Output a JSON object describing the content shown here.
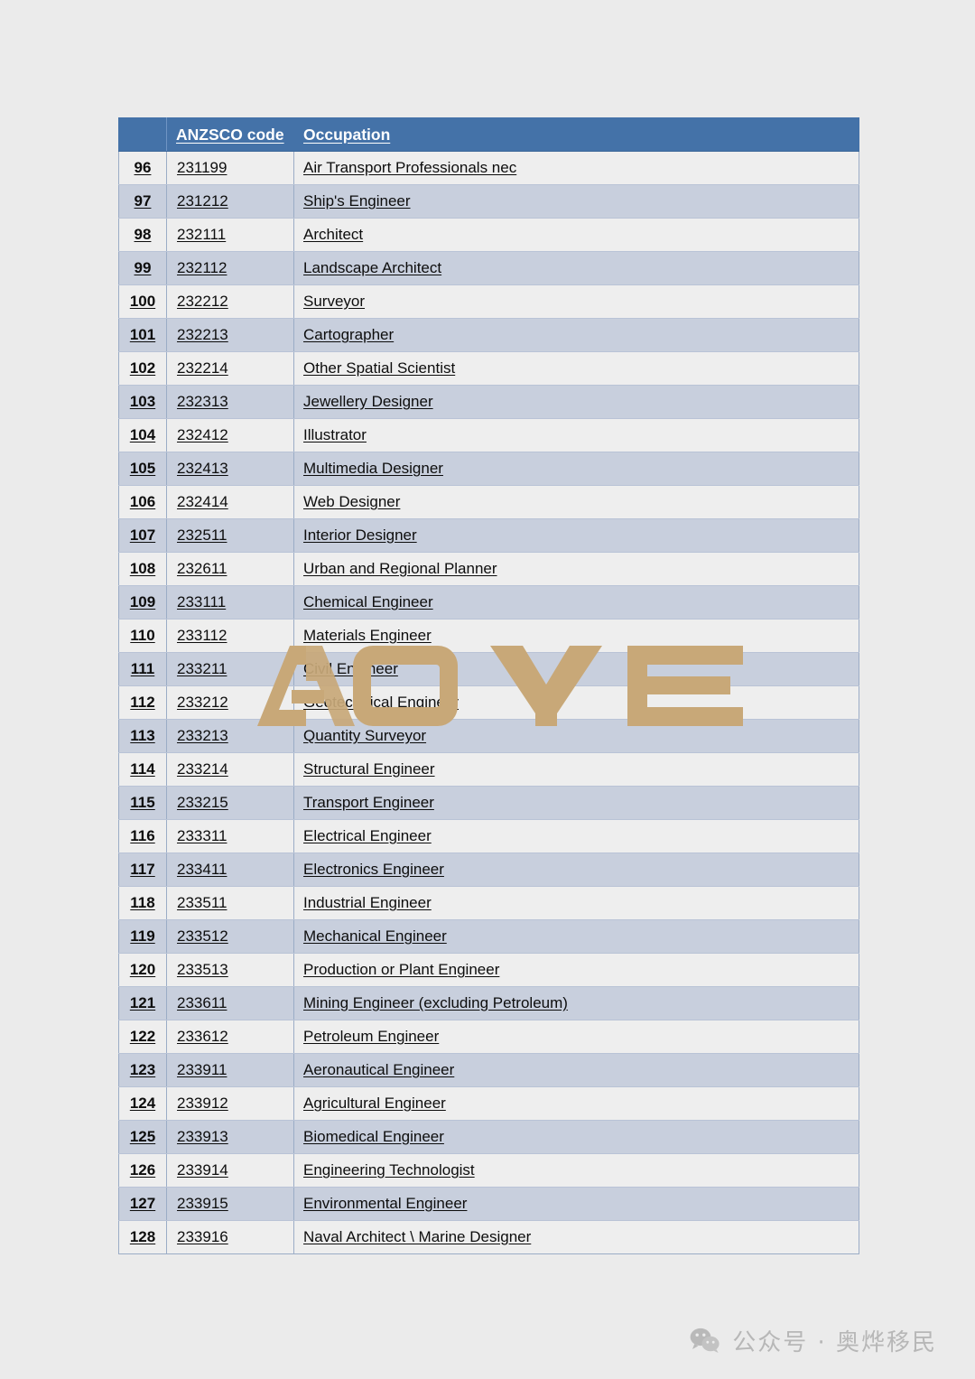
{
  "page": {
    "background_color": "#ebebeb"
  },
  "watermark": {
    "text": "AOYE",
    "color": "#c8a878"
  },
  "table": {
    "header": {
      "index_label": "",
      "code_label": "ANZSCO code",
      "occupation_label": "Occupation",
      "header_bg": "#4472A8",
      "header_text_color": "#ffffff"
    },
    "row_colors": {
      "odd": "#eeeeee",
      "even": "#c8cfdd"
    },
    "rows": [
      {
        "index": "96",
        "code": "231199",
        "occupation": "Air Transport Professionals nec"
      },
      {
        "index": "97",
        "code": "231212",
        "occupation": "Ship's Engineer"
      },
      {
        "index": "98",
        "code": "232111",
        "occupation": "Architect"
      },
      {
        "index": "99",
        "code": "232112",
        "occupation": "Landscape Architect"
      },
      {
        "index": "100",
        "code": "232212",
        "occupation": "Surveyor"
      },
      {
        "index": "101",
        "code": "232213",
        "occupation": "Cartographer"
      },
      {
        "index": "102",
        "code": "232214",
        "occupation": "Other Spatial Scientist"
      },
      {
        "index": "103",
        "code": "232313",
        "occupation": "Jewellery Designer"
      },
      {
        "index": "104",
        "code": "232412",
        "occupation": "Illustrator"
      },
      {
        "index": "105",
        "code": "232413",
        "occupation": "Multimedia Designer"
      },
      {
        "index": "106",
        "code": "232414",
        "occupation": "Web Designer"
      },
      {
        "index": "107",
        "code": "232511",
        "occupation": "Interior Designer"
      },
      {
        "index": "108",
        "code": "232611",
        "occupation": "Urban and Regional Planner"
      },
      {
        "index": "109",
        "code": "233111",
        "occupation": "Chemical Engineer"
      },
      {
        "index": "110",
        "code": "233112",
        "occupation": "Materials Engineer"
      },
      {
        "index": "111",
        "code": "233211",
        "occupation": "Civil Engineer"
      },
      {
        "index": "112",
        "code": "233212",
        "occupation": "Geotechnical Engineer"
      },
      {
        "index": "113",
        "code": "233213",
        "occupation": "Quantity Surveyor"
      },
      {
        "index": "114",
        "code": "233214",
        "occupation": "Structural Engineer"
      },
      {
        "index": "115",
        "code": "233215",
        "occupation": "Transport Engineer"
      },
      {
        "index": "116",
        "code": "233311",
        "occupation": "Electrical Engineer"
      },
      {
        "index": "117",
        "code": "233411",
        "occupation": "Electronics Engineer"
      },
      {
        "index": "118",
        "code": "233511",
        "occupation": "Industrial Engineer"
      },
      {
        "index": "119",
        "code": "233512",
        "occupation": "Mechanical Engineer"
      },
      {
        "index": "120",
        "code": "233513",
        "occupation": "Production or Plant Engineer"
      },
      {
        "index": "121",
        "code": "233611",
        "occupation": "Mining Engineer (excluding Petroleum)"
      },
      {
        "index": "122",
        "code": "233612",
        "occupation": "Petroleum Engineer"
      },
      {
        "index": "123",
        "code": "233911",
        "occupation": "Aeronautical Engineer"
      },
      {
        "index": "124",
        "code": "233912",
        "occupation": "Agricultural Engineer"
      },
      {
        "index": "125",
        "code": "233913",
        "occupation": "Biomedical Engineer"
      },
      {
        "index": "126",
        "code": "233914",
        "occupation": "Engineering Technologist"
      },
      {
        "index": "127",
        "code": "233915",
        "occupation": "Environmental Engineer"
      },
      {
        "index": "128",
        "code": "233916",
        "occupation": "Naval Architect \\ Marine Designer"
      }
    ]
  },
  "footer": {
    "icon": "wechat-icon",
    "text": "公众号 · 奥烨移民",
    "text_color": "#b7b7b7"
  }
}
